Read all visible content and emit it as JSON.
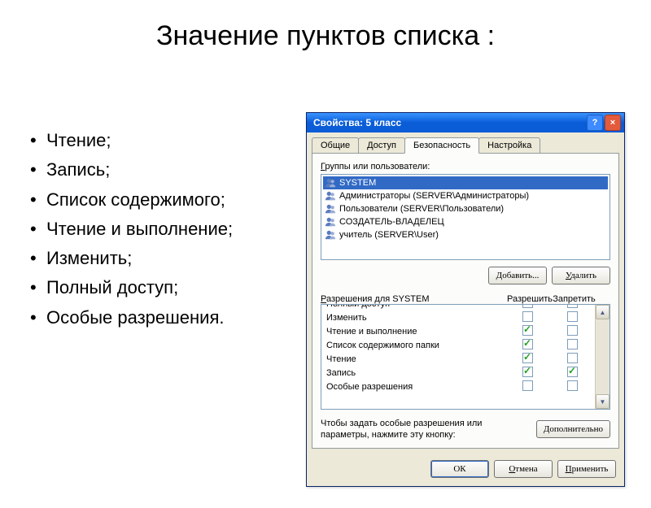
{
  "slide": {
    "title": "Значение пунктов списка :",
    "bullets": [
      "Чтение;",
      "Запись;",
      "Список содержимого;",
      "Чтение и выполнение;",
      "Изменить;",
      "Полный доступ;",
      "Особые разрешения."
    ]
  },
  "dialog": {
    "title": "Свойства: 5 класс",
    "help": "?",
    "close": "×",
    "tabs": [
      "Общие",
      "Доступ",
      "Безопасность",
      "Настройка"
    ],
    "active_tab": 2,
    "groups_label_pre": "Г",
    "groups_label_rest": "руппы или пользователи:",
    "groups": [
      "SYSTEM",
      "Администраторы (SERVER\\Администраторы)",
      "Пользователи (SERVER\\Пользователи)",
      "СОЗДАТЕЛЬ-ВЛАДЕЛЕЦ",
      "учитель (SERVER\\User)"
    ],
    "selected_group": 0,
    "add_btn_pre": "Д",
    "add_btn_rest": "обавить...",
    "remove_btn_pre": "У",
    "remove_btn_rest": "далить",
    "perm_label_pre": "Р",
    "perm_label_rest": "азрешения для SYSTEM",
    "col_allow": "Разрешить",
    "col_deny": "Запретить",
    "perms": [
      {
        "name": "Полный доступ",
        "allow": false,
        "deny": false,
        "cut": true
      },
      {
        "name": "Изменить",
        "allow": false,
        "deny": false
      },
      {
        "name": "Чтение и выполнение",
        "allow": true,
        "deny": false
      },
      {
        "name": "Список содержимого папки",
        "allow": true,
        "deny": false
      },
      {
        "name": "Чтение",
        "allow": true,
        "deny": false
      },
      {
        "name": "Запись",
        "allow": true,
        "deny": true
      },
      {
        "name": "Особые разрешения",
        "allow": false,
        "deny": false
      }
    ],
    "adv_text": "Чтобы задать особые разрешения или параметры, нажмите эту кнопку:",
    "adv_btn_pre": "Д",
    "adv_btn_rest": "ополнительно",
    "ok": "ОК",
    "cancel_pre": "О",
    "cancel_rest": "тмена",
    "apply_pre": "П",
    "apply_rest": "рименить"
  }
}
